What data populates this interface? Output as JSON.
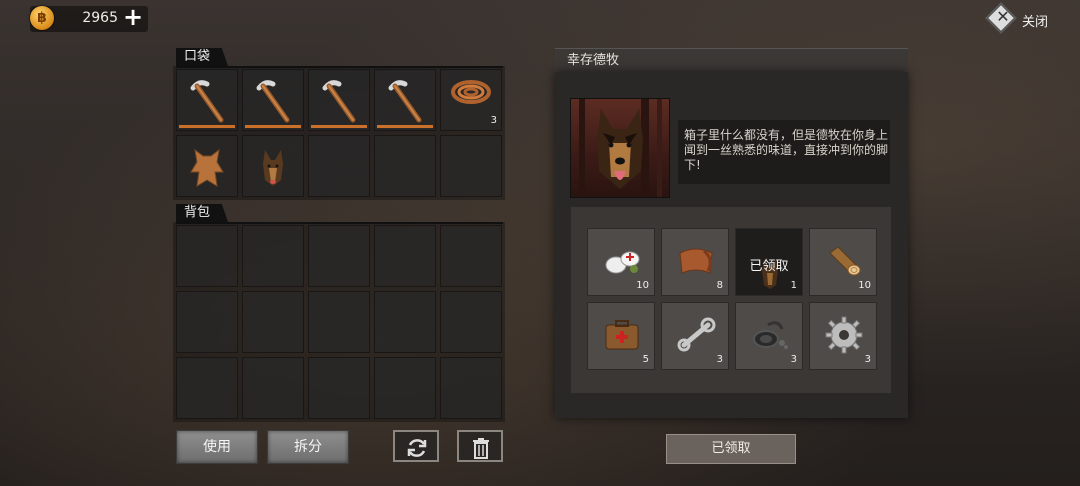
{
  "topbar": {
    "coin_symbol": "฿",
    "coins": "2965",
    "plus": "+",
    "close_label": "关闭",
    "close_x": "✕"
  },
  "pocket": {
    "title": "口袋",
    "slots": [
      {
        "icon": "pickaxe-icon",
        "durability": true
      },
      {
        "icon": "pickaxe-icon",
        "durability": true
      },
      {
        "icon": "pickaxe-icon",
        "durability": true
      },
      {
        "icon": "pickaxe-icon",
        "durability": true
      },
      {
        "icon": "rope-icon",
        "count": "3"
      },
      {
        "icon": "fur-hide-icon"
      },
      {
        "icon": "dog-icon"
      },
      {},
      {},
      {}
    ]
  },
  "backpack": {
    "title": "背包",
    "slot_count": 15
  },
  "actions": {
    "use_label": "使用",
    "split_label": "拆分",
    "sort_icon": "refresh-icon",
    "trash_icon": "trash-icon"
  },
  "event": {
    "title": "幸存德牧",
    "description": "箱子里什么都没有，但是德牧在你身上闻到一丝熟悉的味道，直接冲到你的脚下!",
    "portrait": "german-shepherd-portrait",
    "rewards": [
      {
        "icon": "bandage-icon",
        "count": "10"
      },
      {
        "icon": "leather-icon",
        "count": "8"
      },
      {
        "icon": "dog-icon",
        "count": "1",
        "claimed_label": "已领取"
      },
      {
        "icon": "wood-log-icon",
        "count": "10"
      },
      {
        "icon": "medkit-icon",
        "count": "5"
      },
      {
        "icon": "wrench-icon",
        "count": "3"
      },
      {
        "icon": "cable-icon",
        "count": "3"
      },
      {
        "icon": "gear-icon",
        "count": "3"
      }
    ],
    "claim_button_label": "已领取"
  },
  "colors": {
    "durability": "#c9702a",
    "coin": "#e8a024"
  }
}
